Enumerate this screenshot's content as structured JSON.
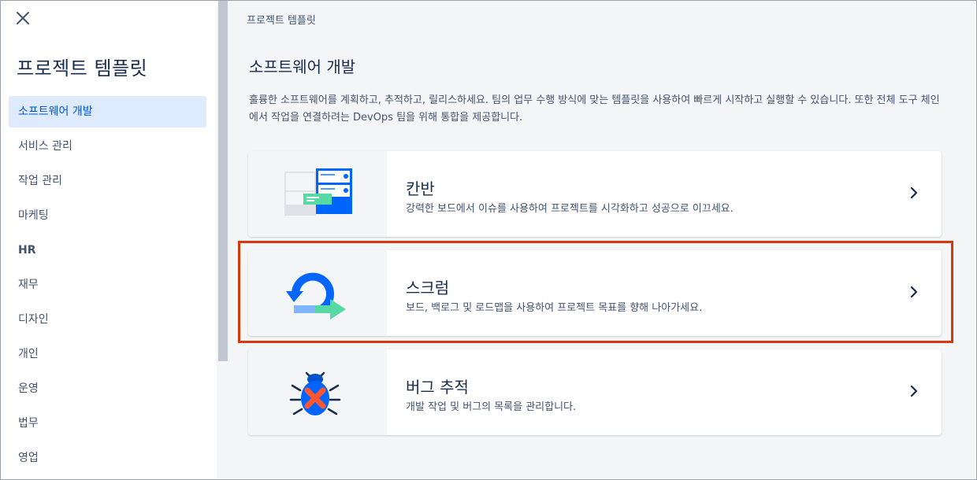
{
  "sidebar": {
    "close_icon": "close-icon",
    "title": "프로젝트 템플릿",
    "items": [
      {
        "label": "소프트웨어 개발",
        "active": true
      },
      {
        "label": "서비스 관리"
      },
      {
        "label": "작업 관리"
      },
      {
        "label": "마케팅"
      },
      {
        "label": "HR"
      },
      {
        "label": "재무"
      },
      {
        "label": "디자인"
      },
      {
        "label": "개인"
      },
      {
        "label": "운영"
      },
      {
        "label": "법무"
      },
      {
        "label": "영업"
      }
    ]
  },
  "main": {
    "breadcrumb": "프로젝트 템플릿",
    "title": "소프트웨어 개발",
    "description": "훌륭한 소프트웨어를 계획하고, 추적하고, 릴리스하세요. 팀의 업무 수행 방식에 맞는 템플릿을 사용하여 빠르게 시작하고 실행할 수 있습니다. 또한 전체 도구 체인에서 작업을 연결하려는 DevOps 팀을 위해 통합을 제공합니다.",
    "cards": [
      {
        "title": "칸반",
        "description": "강력한 보드에서 이슈를 사용하여 프로젝트를 시각화하고 성공으로 이끄세요.",
        "icon": "kanban-board-icon"
      },
      {
        "title": "스크럼",
        "description": "보드, 백로그 및 로드맵을 사용하여 프로젝트 목표를 향해 나아가세요.",
        "icon": "scrum-cycle-icon",
        "highlighted": true
      },
      {
        "title": "버그 추적",
        "description": "개발 작업 및 버그의 목록을 관리합니다.",
        "icon": "bug-icon"
      }
    ]
  },
  "colors": {
    "accent": "#0052CC",
    "active_bg": "#DEEBFF",
    "highlight": "#D9380E",
    "panel_bg": "#F4F5F7"
  }
}
